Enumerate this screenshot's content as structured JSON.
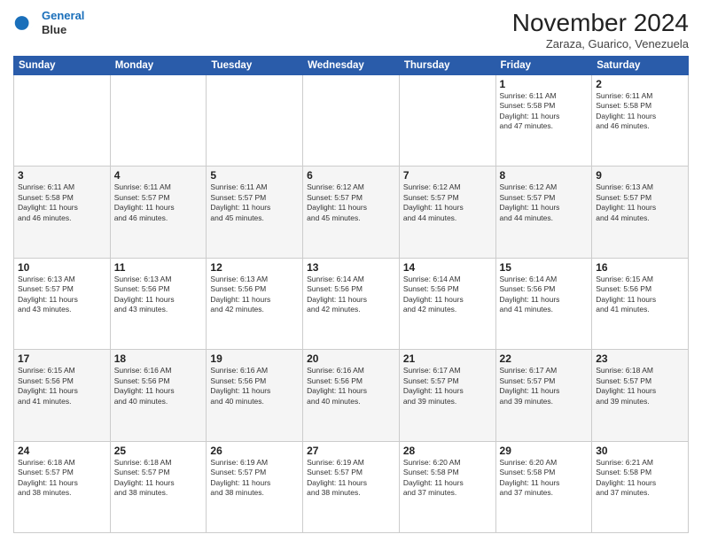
{
  "logo": {
    "line1": "General",
    "line2": "Blue"
  },
  "header": {
    "title": "November 2024",
    "location": "Zaraza, Guarico, Venezuela"
  },
  "weekdays": [
    "Sunday",
    "Monday",
    "Tuesday",
    "Wednesday",
    "Thursday",
    "Friday",
    "Saturday"
  ],
  "weeks": [
    [
      {
        "day": "",
        "info": ""
      },
      {
        "day": "",
        "info": ""
      },
      {
        "day": "",
        "info": ""
      },
      {
        "day": "",
        "info": ""
      },
      {
        "day": "",
        "info": ""
      },
      {
        "day": "1",
        "info": "Sunrise: 6:11 AM\nSunset: 5:58 PM\nDaylight: 11 hours\nand 47 minutes."
      },
      {
        "day": "2",
        "info": "Sunrise: 6:11 AM\nSunset: 5:58 PM\nDaylight: 11 hours\nand 46 minutes."
      }
    ],
    [
      {
        "day": "3",
        "info": "Sunrise: 6:11 AM\nSunset: 5:58 PM\nDaylight: 11 hours\nand 46 minutes."
      },
      {
        "day": "4",
        "info": "Sunrise: 6:11 AM\nSunset: 5:57 PM\nDaylight: 11 hours\nand 46 minutes."
      },
      {
        "day": "5",
        "info": "Sunrise: 6:11 AM\nSunset: 5:57 PM\nDaylight: 11 hours\nand 45 minutes."
      },
      {
        "day": "6",
        "info": "Sunrise: 6:12 AM\nSunset: 5:57 PM\nDaylight: 11 hours\nand 45 minutes."
      },
      {
        "day": "7",
        "info": "Sunrise: 6:12 AM\nSunset: 5:57 PM\nDaylight: 11 hours\nand 44 minutes."
      },
      {
        "day": "8",
        "info": "Sunrise: 6:12 AM\nSunset: 5:57 PM\nDaylight: 11 hours\nand 44 minutes."
      },
      {
        "day": "9",
        "info": "Sunrise: 6:13 AM\nSunset: 5:57 PM\nDaylight: 11 hours\nand 44 minutes."
      }
    ],
    [
      {
        "day": "10",
        "info": "Sunrise: 6:13 AM\nSunset: 5:57 PM\nDaylight: 11 hours\nand 43 minutes."
      },
      {
        "day": "11",
        "info": "Sunrise: 6:13 AM\nSunset: 5:56 PM\nDaylight: 11 hours\nand 43 minutes."
      },
      {
        "day": "12",
        "info": "Sunrise: 6:13 AM\nSunset: 5:56 PM\nDaylight: 11 hours\nand 42 minutes."
      },
      {
        "day": "13",
        "info": "Sunrise: 6:14 AM\nSunset: 5:56 PM\nDaylight: 11 hours\nand 42 minutes."
      },
      {
        "day": "14",
        "info": "Sunrise: 6:14 AM\nSunset: 5:56 PM\nDaylight: 11 hours\nand 42 minutes."
      },
      {
        "day": "15",
        "info": "Sunrise: 6:14 AM\nSunset: 5:56 PM\nDaylight: 11 hours\nand 41 minutes."
      },
      {
        "day": "16",
        "info": "Sunrise: 6:15 AM\nSunset: 5:56 PM\nDaylight: 11 hours\nand 41 minutes."
      }
    ],
    [
      {
        "day": "17",
        "info": "Sunrise: 6:15 AM\nSunset: 5:56 PM\nDaylight: 11 hours\nand 41 minutes."
      },
      {
        "day": "18",
        "info": "Sunrise: 6:16 AM\nSunset: 5:56 PM\nDaylight: 11 hours\nand 40 minutes."
      },
      {
        "day": "19",
        "info": "Sunrise: 6:16 AM\nSunset: 5:56 PM\nDaylight: 11 hours\nand 40 minutes."
      },
      {
        "day": "20",
        "info": "Sunrise: 6:16 AM\nSunset: 5:56 PM\nDaylight: 11 hours\nand 40 minutes."
      },
      {
        "day": "21",
        "info": "Sunrise: 6:17 AM\nSunset: 5:57 PM\nDaylight: 11 hours\nand 39 minutes."
      },
      {
        "day": "22",
        "info": "Sunrise: 6:17 AM\nSunset: 5:57 PM\nDaylight: 11 hours\nand 39 minutes."
      },
      {
        "day": "23",
        "info": "Sunrise: 6:18 AM\nSunset: 5:57 PM\nDaylight: 11 hours\nand 39 minutes."
      }
    ],
    [
      {
        "day": "24",
        "info": "Sunrise: 6:18 AM\nSunset: 5:57 PM\nDaylight: 11 hours\nand 38 minutes."
      },
      {
        "day": "25",
        "info": "Sunrise: 6:18 AM\nSunset: 5:57 PM\nDaylight: 11 hours\nand 38 minutes."
      },
      {
        "day": "26",
        "info": "Sunrise: 6:19 AM\nSunset: 5:57 PM\nDaylight: 11 hours\nand 38 minutes."
      },
      {
        "day": "27",
        "info": "Sunrise: 6:19 AM\nSunset: 5:57 PM\nDaylight: 11 hours\nand 38 minutes."
      },
      {
        "day": "28",
        "info": "Sunrise: 6:20 AM\nSunset: 5:58 PM\nDaylight: 11 hours\nand 37 minutes."
      },
      {
        "day": "29",
        "info": "Sunrise: 6:20 AM\nSunset: 5:58 PM\nDaylight: 11 hours\nand 37 minutes."
      },
      {
        "day": "30",
        "info": "Sunrise: 6:21 AM\nSunset: 5:58 PM\nDaylight: 11 hours\nand 37 minutes."
      }
    ]
  ]
}
